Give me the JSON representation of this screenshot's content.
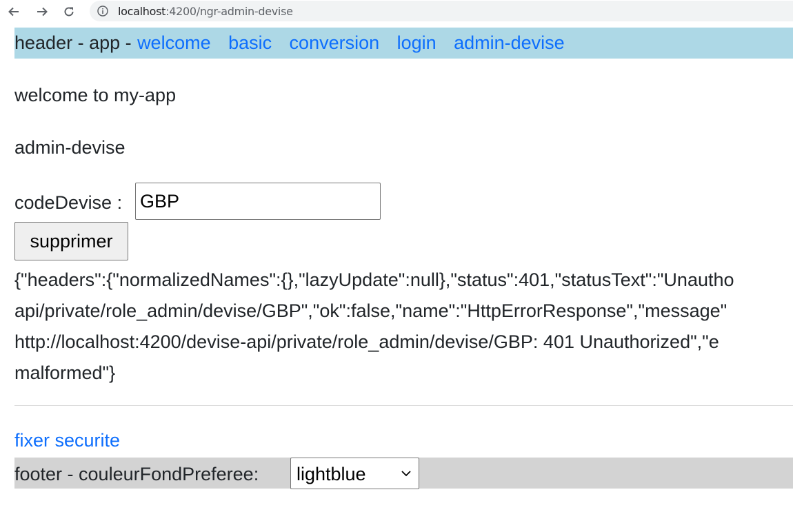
{
  "browser": {
    "url_host": "localhost",
    "url_path": ":4200/ngr-admin-devise"
  },
  "header": {
    "prefix": "header - app -",
    "links": [
      "welcome",
      "basic",
      "conversion",
      "login",
      "admin-devise"
    ]
  },
  "main": {
    "welcome_text": "welcome to my-app",
    "section_title": "admin-devise",
    "code_devise_label": "codeDevise :",
    "code_devise_value": "GBP",
    "delete_button_label": "supprimer",
    "error_lines": [
      "{\"headers\":{\"normalizedNames\":{},\"lazyUpdate\":null},\"status\":401,\"statusText\":\"Unautho",
      "api/private/role_admin/devise/GBP\",\"ok\":false,\"name\":\"HttpErrorResponse\",\"message\"",
      "http://localhost:4200/devise-api/private/role_admin/devise/GBP: 401 Unauthorized\",\"e",
      "malformed\"}"
    ],
    "security_link": "fixer securite"
  },
  "footer": {
    "label": "footer - couleurFondPreferee:",
    "selected_color": "lightblue"
  },
  "colors": {
    "header_bg": "#add8e6",
    "footer_bg": "#d3d3d3",
    "link": "#0d6efd"
  }
}
